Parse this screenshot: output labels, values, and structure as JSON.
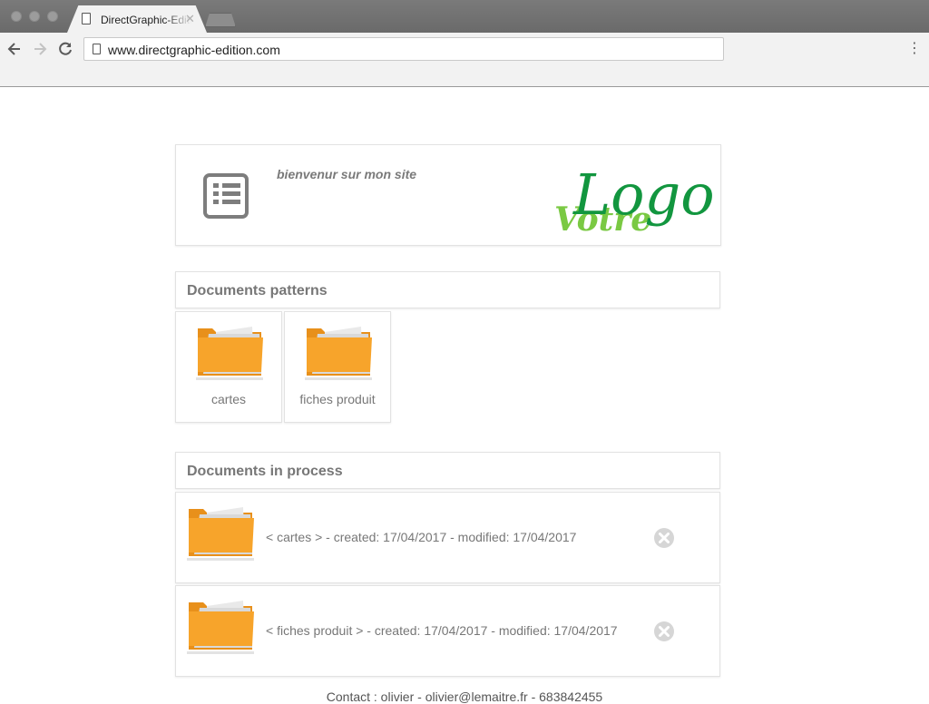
{
  "browser": {
    "tab_title": "DirectGraphic-Edition",
    "url": "www.directgraphic-edition.com",
    "icons": {
      "back": "arrow-left-icon",
      "forward": "arrow-right-icon",
      "reload": "reload-icon",
      "menu": "menu-dots-icon"
    }
  },
  "header": {
    "welcome": "bienvenur sur mon site",
    "logo": {
      "word1": "Logo",
      "word2": "Votre",
      "color_dark": "#12963f",
      "color_light": "#7ac943"
    }
  },
  "patterns": {
    "title": "Documents patterns",
    "items": [
      {
        "label": "cartes"
      },
      {
        "label": "fiches produit"
      }
    ]
  },
  "in_process": {
    "title": "Documents in process",
    "items": [
      {
        "text": "< cartes > - created: 17/04/2017 - modified: 17/04/2017"
      },
      {
        "text": "< fiches produit > - created: 17/04/2017 - modified: 17/04/2017"
      }
    ]
  },
  "footer": {
    "text": "Contact : olivier - olivier@lemaitre.fr - 683842455"
  },
  "colors": {
    "folder": "#f7a42b",
    "folder_dark": "#e8901b",
    "text": "#777777"
  }
}
